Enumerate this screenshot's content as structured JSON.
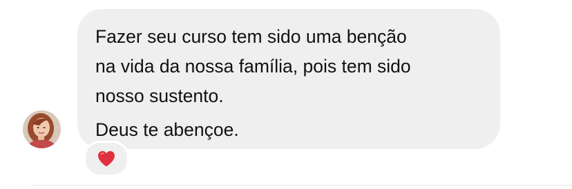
{
  "message": {
    "paragraphs": [
      {
        "lines": [
          "Fazer seu curso tem sido uma benção",
          "na vida da nossa família, pois tem sido",
          "nosso sustento."
        ]
      },
      {
        "lines": [
          "Deus te abençoe."
        ]
      }
    ],
    "reaction": {
      "icon": "heart-icon",
      "color": "#e0303f"
    }
  },
  "sender": {
    "avatar": "avatar-photo"
  },
  "colors": {
    "bubble": "#efefef",
    "text": "#111111",
    "background": "#ffffff"
  }
}
